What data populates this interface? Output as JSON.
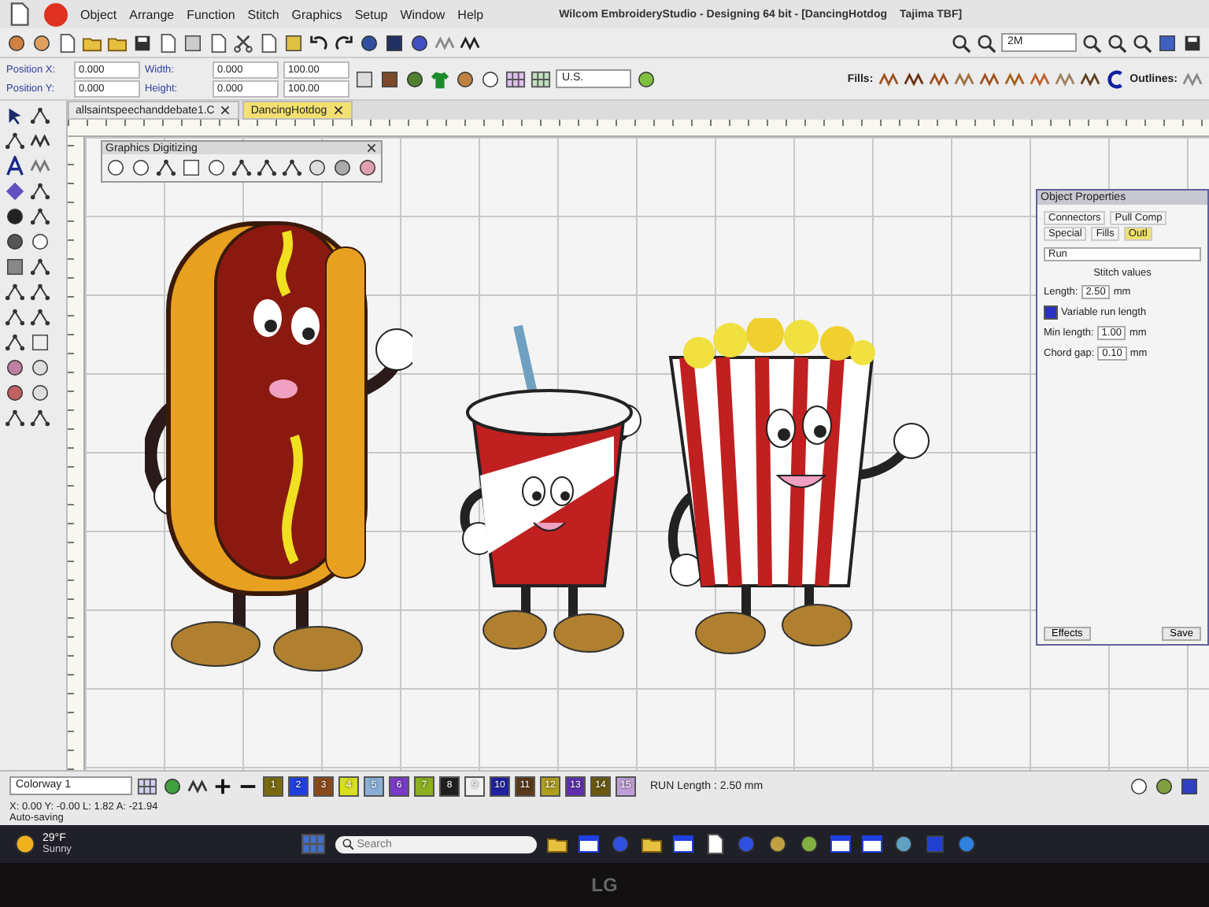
{
  "menu": [
    "Object",
    "Arrange",
    "Function",
    "Stitch",
    "Graphics",
    "Setup",
    "Window",
    "Help"
  ],
  "title_bar": {
    "title": "Wilcom EmbroideryStudio - Designing 64 bit - [DancingHotdog",
    "machine": "Tajima TBF]"
  },
  "toolbar": {
    "units": "U.S.",
    "zoom_value": "2M",
    "fills_label": "Fills:",
    "outlines_label": "Outlines:"
  },
  "transform": {
    "position": [
      {
        "label": "Position X:",
        "value": "0.000"
      },
      {
        "label": "Position Y:",
        "value": "0.000"
      }
    ],
    "size": [
      {
        "label": "Width:",
        "value": "0.000",
        "scale": "100.00"
      },
      {
        "label": "Height:",
        "value": "0.000",
        "scale": "100.00"
      }
    ]
  },
  "doc_tabs": [
    {
      "label": "allsaintspeechanddebate1.C",
      "selected": false
    },
    {
      "label": "DancingHotdog",
      "selected": true
    }
  ],
  "palette_window": {
    "title": "Graphics Digitizing"
  },
  "properties": {
    "title": "Object Properties",
    "tabs": [
      {
        "label": "Connectors",
        "selected": false
      },
      {
        "label": "Pull Comp",
        "selected": false
      },
      {
        "label": "Special",
        "selected": false
      },
      {
        "label": "Fills",
        "selected": false
      },
      {
        "label": "Outl",
        "selected": true
      }
    ],
    "stitch_type": "Run",
    "section": "Stitch values",
    "length": {
      "label": "Length:",
      "value": "2.50",
      "unit": "mm"
    },
    "variable": {
      "label": "Variable run length",
      "checked": true
    },
    "fields": [
      {
        "label": "Min length:",
        "value": "1.00",
        "unit": "mm"
      },
      {
        "label": "Chord gap:",
        "value": "0.10",
        "unit": "mm"
      }
    ],
    "buttons": [
      "Effects",
      "Save"
    ]
  },
  "color_bar": {
    "colorway": "Colorway 1",
    "stitch_info": "RUN Length : 2.50 mm",
    "swatches": [
      {
        "label": "1",
        "color": "#7a6a10"
      },
      {
        "label": "2",
        "color": "#1f3fe0"
      },
      {
        "label": "3",
        "color": "#8a4a1a"
      },
      {
        "label": "4",
        "color": "#d8e020"
      },
      {
        "label": "5",
        "color": "#8ab0d8"
      },
      {
        "label": "6",
        "color": "#7a3ac8"
      },
      {
        "label": "7",
        "color": "#8ab020"
      },
      {
        "label": "8",
        "color": "#202020"
      },
      {
        "label": "9",
        "color": "#f0f0f0"
      },
      {
        "label": "10",
        "color": "#2020a0"
      },
      {
        "label": "11",
        "color": "#5a3a1a"
      },
      {
        "label": "12",
        "color": "#b0a020"
      },
      {
        "label": "13",
        "color": "#6030b0"
      },
      {
        "label": "14",
        "color": "#6a5a10"
      },
      {
        "label": "15",
        "color": "#c0a0d8"
      }
    ]
  },
  "status_bar": {
    "coords": "X: 0.00  Y: -0.00  L: 1.82  A: -21.94",
    "message": "Auto-saving"
  },
  "taskbar": {
    "weather_temp": "29°F",
    "weather_condition": "Sunny",
    "search": {
      "placeholder": "Search"
    }
  },
  "monitor": {
    "brand": "LG"
  }
}
